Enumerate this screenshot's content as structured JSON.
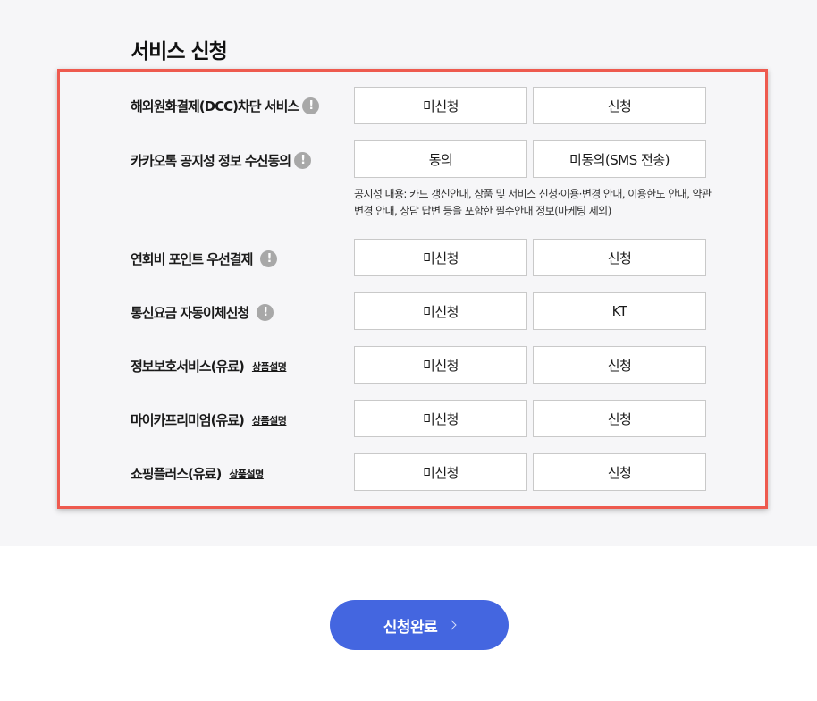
{
  "section": {
    "title": "서비스 신청"
  },
  "services": [
    {
      "label": "해외원화결제(DCC)차단 서비스",
      "info_icon": "!",
      "options": [
        "미신청",
        "신청"
      ]
    },
    {
      "label": "카카오톡 공지성 정보 수신동의",
      "info_icon": "!",
      "options": [
        "동의",
        "미동의(SMS 전송)"
      ],
      "notice": "공지성 내용: 카드 갱신안내, 상품 및 서비스 신청·이용·변경 안내, 이용한도 안내, 약관변경 안내, 상담 답변 등을 포함한 필수안내 정보(마케팅 제외)"
    },
    {
      "label": "연회비 포인트 우선결제",
      "info_icon": "!",
      "options": [
        "미신청",
        "신청"
      ]
    },
    {
      "label": "통신요금 자동이체신청",
      "info_icon": "!",
      "options": [
        "미신청",
        "KT"
      ]
    },
    {
      "label": "정보보호서비스(유료)",
      "detail_link": "상품설명",
      "options": [
        "미신청",
        "신청"
      ]
    },
    {
      "label": "마이카프리미엄(유료)",
      "detail_link": "상품설명",
      "options": [
        "미신청",
        "신청"
      ]
    },
    {
      "label": "쇼핑플러스(유료)",
      "detail_link": "상품설명",
      "options": [
        "미신청",
        "신청"
      ]
    }
  ],
  "submit": {
    "label": "신청완료",
    "icon": "chevron-right-icon"
  },
  "colors": {
    "accent": "#4466e0",
    "highlight": "#ee5a4f",
    "background": "#f6f6f8"
  }
}
